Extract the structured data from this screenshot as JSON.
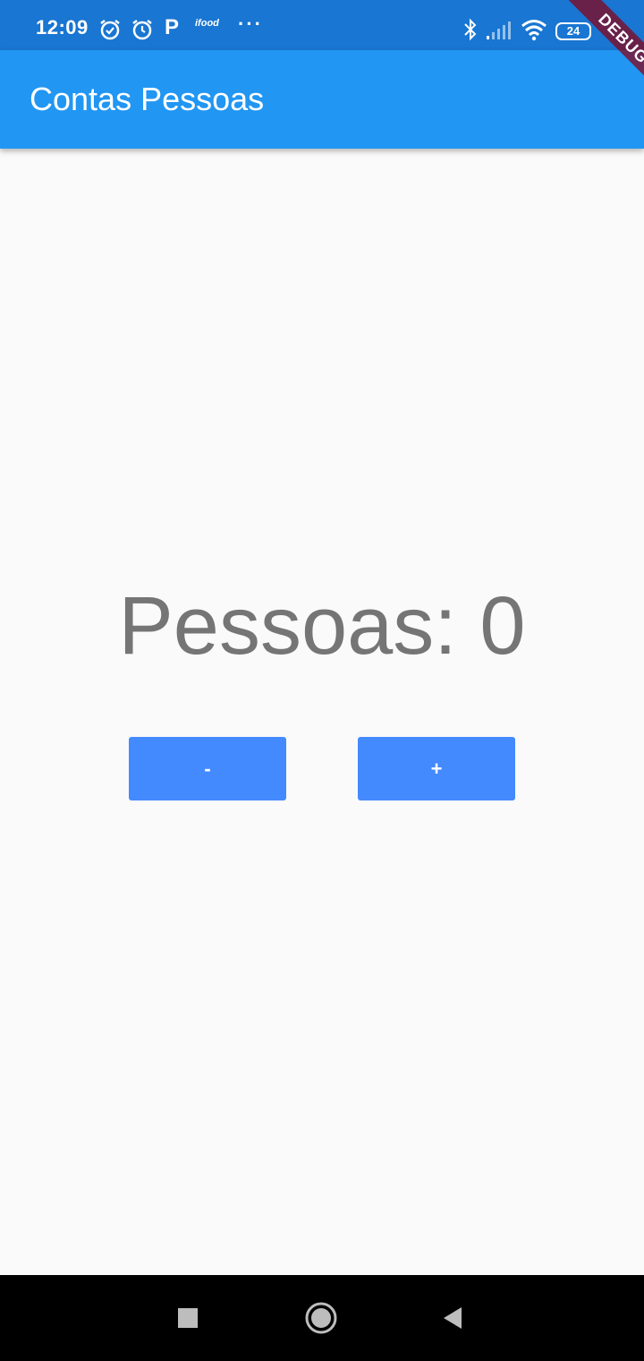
{
  "status_bar": {
    "time": "12:09",
    "icons": [
      "alarm-check-icon",
      "alarm-icon",
      "p-app-icon",
      "ifood-icon",
      "more-dots-icon",
      "bluetooth-icon",
      "signal-icon",
      "wifi-icon",
      "battery-icon"
    ],
    "p_label": "P",
    "ifood_label": "ifood",
    "more_label": "···",
    "battery_level": "24"
  },
  "debug_banner": "DEBUG",
  "app_bar": {
    "title": "Contas Pessoas",
    "color": "#2196f3"
  },
  "main": {
    "counter_text": "Pessoas: 0",
    "minus_label": "-",
    "plus_label": "+",
    "button_color": "#448aff"
  },
  "nav_bar": {
    "icons": [
      "recents-square-icon",
      "home-circle-icon",
      "back-triangle-icon"
    ]
  }
}
